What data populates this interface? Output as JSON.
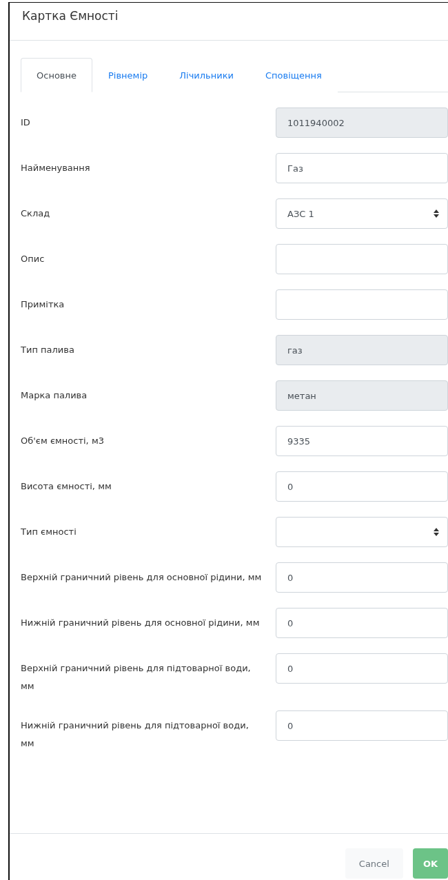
{
  "window": {
    "title": "Картка Ємності"
  },
  "tabs": [
    {
      "label": "Основне",
      "selected": true
    },
    {
      "label": "Рівнемір",
      "selected": false
    },
    {
      "label": "Лічильники",
      "selected": false
    },
    {
      "label": "Сповіщення",
      "selected": false
    }
  ],
  "fields": [
    {
      "label": "ID",
      "kind": "input",
      "value": "1011940002",
      "disabled": true
    },
    {
      "label": "Найменування",
      "kind": "input",
      "value": "Газ",
      "disabled": false
    },
    {
      "label": "Склад",
      "kind": "select",
      "value": "АЗС 1",
      "disabled": false
    },
    {
      "label": "Опис",
      "kind": "input",
      "disabled": false
    },
    {
      "label": "Примітка",
      "kind": "input",
      "disabled": false
    },
    {
      "label": "Тип палива",
      "kind": "input",
      "value": "газ",
      "disabled": true
    },
    {
      "label": "Марка палива",
      "kind": "input",
      "value": "метан",
      "disabled": true
    },
    {
      "label": "Об'єм ємності, м3",
      "kind": "input",
      "value": "9335",
      "disabled": false
    },
    {
      "label": "Висота ємності, мм",
      "kind": "input",
      "value": "0",
      "disabled": false
    },
    {
      "label": "Тип ємності",
      "kind": "select",
      "disabled": false
    },
    {
      "label": "Верхній граничний рівень для основної рідини, мм",
      "kind": "input",
      "value": "0",
      "disabled": false
    },
    {
      "label": "Нижній граничний рівень для основної рідини, мм",
      "kind": "input",
      "value": "0",
      "disabled": false
    },
    {
      "label": "Верхній граничний рівень для підтоварної води, мм",
      "kind": "input",
      "value": "0",
      "disabled": false
    },
    {
      "label": "Нижній граничний рівень для підтоварної води, мм",
      "kind": "input",
      "value": "0",
      "disabled": false
    }
  ],
  "buttons": [
    {
      "label": "Cancel",
      "kind": "secondary"
    },
    {
      "label": "OK",
      "kind": "primary"
    }
  ]
}
